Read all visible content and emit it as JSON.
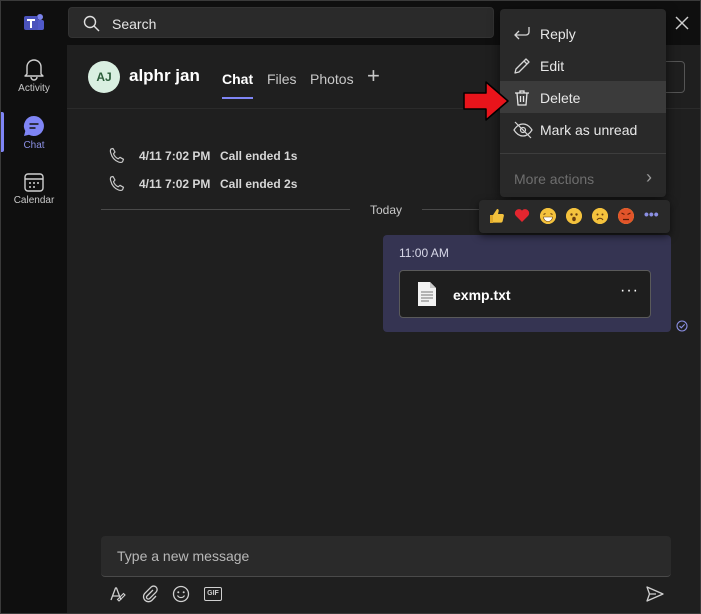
{
  "app": {
    "name": "Microsoft Teams"
  },
  "search": {
    "placeholder": "Search"
  },
  "rail": {
    "items": [
      {
        "label": "Activity",
        "icon": "bell-icon"
      },
      {
        "label": "Chat",
        "icon": "chat-icon",
        "active": true
      },
      {
        "label": "Calendar",
        "icon": "calendar-icon"
      }
    ]
  },
  "chat": {
    "avatar_initials": "AJ",
    "name": "alphr jan",
    "tabs": [
      "Chat",
      "Files",
      "Photos"
    ]
  },
  "calls": [
    {
      "time": "4/11 7:02 PM",
      "desc": "Call ended 1s"
    },
    {
      "time": "4/11 7:02 PM",
      "desc": "Call ended 2s"
    }
  ],
  "divider_label": "Today",
  "message": {
    "time": "11:00 AM",
    "file_name": "exmp.txt",
    "more": "···"
  },
  "context_menu": {
    "items": [
      "Reply",
      "Edit",
      "Delete",
      "Mark as unread"
    ],
    "highlighted": "Delete",
    "more_actions": "More actions"
  },
  "reactions": [
    "like",
    "heart",
    "laugh",
    "surprised",
    "sad",
    "angry"
  ],
  "reactions_more": "•••",
  "compose": {
    "placeholder": "Type a new message",
    "gif_label": "GIF"
  },
  "colors": {
    "accent": "#7f85f5",
    "bubble": "#353452",
    "arrow": "#e8141b"
  }
}
